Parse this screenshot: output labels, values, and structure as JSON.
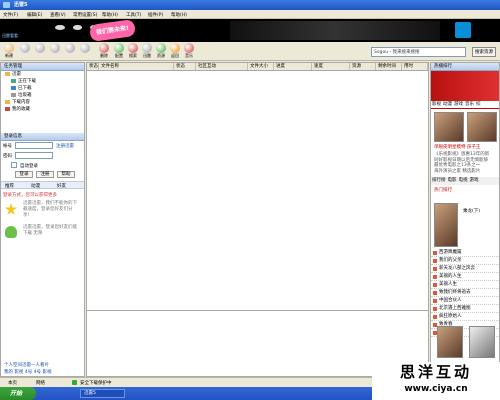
{
  "window": {
    "title": "迅雷5"
  },
  "menu": [
    "文件(F)",
    "编辑(E)",
    "查看(V)",
    "常用设置(S)",
    "帮助(H)",
    "工具(T)",
    "插件(P)",
    "帮助(H)"
  ],
  "banner": {
    "badge": "我们要未来!",
    "brand": "迅雷看看"
  },
  "toolbar": {
    "buttons": [
      "新建",
      "",
      "",
      "",
      "",
      "",
      "",
      "",
      "",
      "删除",
      "配置",
      "搜索",
      "迅雷",
      "资源",
      "返回",
      "音乐"
    ]
  },
  "search": {
    "value": "Sogou - 我来搜来搜搜",
    "button": "搜索资源"
  },
  "left": {
    "task_header": "任务管理",
    "tree": [
      "迅雷",
      "正在下载",
      "已下载",
      "垃圾箱",
      "下载内容",
      "我的收藏"
    ],
    "login_header": "登录信息",
    "account_label": "帐号",
    "register_link": "注册迅雷",
    "password_label": "密码",
    "auto_login": "自动登录",
    "login_btn": "登录",
    "cancel_btn": "注册",
    "help_btn": "帮助",
    "tabs": [
      "推荐",
      "动漫",
      "好友"
    ],
    "tips_title": "登录方式，您可以获得更多",
    "tips": [
      "迅雷迅雷，我们不能你的下载速度，登录您好友们分享！",
      "迅雷迅雷，登录您好友们能下载 无限",
      "好友下载哦"
    ],
    "bottom_links": [
      "个人空间迅雷一人看片",
      "我的 影视 4号 4号 影视"
    ]
  },
  "main": {
    "columns": [
      "状态",
      "文件名称",
      "状态",
      "社区互动",
      "文件大小",
      "进度",
      "速度",
      "资源",
      "剩余时间",
      "用时"
    ]
  },
  "right": {
    "header": "热播排行",
    "tabs": [
      "影视",
      "动漫",
      "游戏",
      "音乐",
      "综"
    ],
    "headline": "单眼皮明星模特 孩子王",
    "desc": [
      "《乐视影视》恩惠13年的新",
      "同好影视日期以后无情能够",
      "最优秀电影之13条之一",
      "海外演员之家 精选影片"
    ],
    "list_tabs": [
      "排行榜",
      "电影",
      "电视",
      "游戏"
    ],
    "featured": "乘龙(下)",
    "items": [
      "西游降魔篇",
      "我们的父亲",
      "新天龙八部之风云",
      "美丽的人生",
      "美丽人生",
      "致我们终将逝去",
      "中国合伙人",
      "北京遇上西雅图",
      "疯狂原始人",
      "致青春",
      "天机"
    ],
    "items_label": "热门排行"
  },
  "status": {
    "left": "本页",
    "mid": "网络",
    "right": "安全下载保护中"
  },
  "taskbar": {
    "start": "开始",
    "task": "迅雷5"
  },
  "watermark": {
    "line1": "思洋互动",
    "line2": "www.ciya.cn"
  }
}
